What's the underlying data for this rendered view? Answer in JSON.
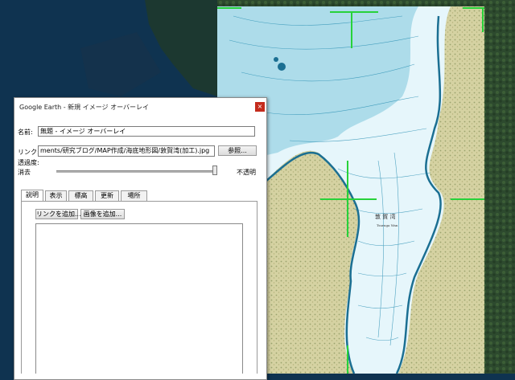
{
  "dialog": {
    "title": "Google Earth - 新規 イメージ オーバーレイ",
    "close_glyph": "×",
    "name_label": "名前:",
    "name_value": "無題 - イメージ オーバーレイ",
    "link_label": "リンク:",
    "link_value": "ments/研究ブログ/MAP作成/海底地形図/敦賀湾(加工).jpg",
    "browse_label": "参照...",
    "transparency_label": "透過度:",
    "clear_label": "消去",
    "opaque_label": "不透明",
    "transparency_value": 1.0,
    "tabs": [
      {
        "label": "説明",
        "active": true
      },
      {
        "label": "表示",
        "active": false
      },
      {
        "label": "標高",
        "active": false
      },
      {
        "label": "更新",
        "active": false
      },
      {
        "label": "場所",
        "active": false
      }
    ],
    "add_link_label": "リンクを追加...",
    "add_image_label": "画像を追加..."
  },
  "map": {
    "bay_label": "敦 賀 湾",
    "bay_label_roman": "Tsuruga Wan",
    "colors": {
      "sea": "#0f3350",
      "water": "#e8f6fb",
      "contour": "#2a8fb3",
      "land": "#d7d3a4",
      "pin": "#27d23a"
    }
  }
}
